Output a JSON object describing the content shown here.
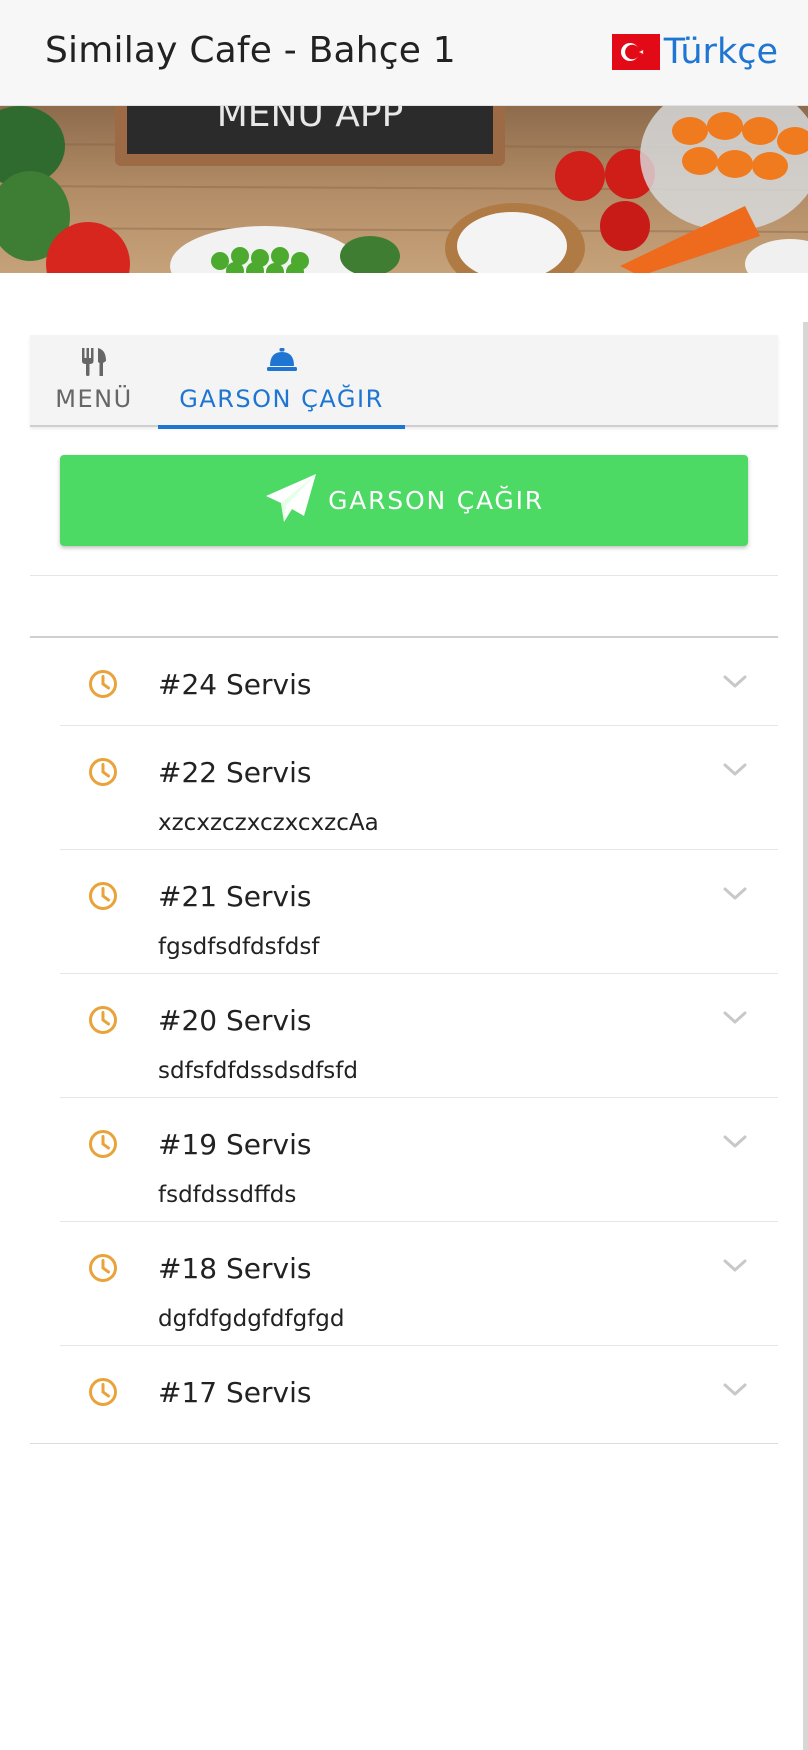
{
  "header": {
    "title": "Similay Cafe - Bahçe 1",
    "language_label": "Türkçe",
    "flag_icon": "turkey-flag-icon"
  },
  "banner": {
    "chalkboard_text": "MENU APP"
  },
  "tabs": [
    {
      "label": "MENÜ",
      "icon": "fork-knife-icon",
      "active": false
    },
    {
      "label": "GARSON ÇAĞIR",
      "icon": "service-bell-icon",
      "active": true
    }
  ],
  "call_button": {
    "label": "GARSON ÇAĞIR",
    "icon": "paper-plane-icon",
    "color": "#4cd964"
  },
  "requests": [
    {
      "title": "#24 Servis",
      "note": ""
    },
    {
      "title": "#22 Servis",
      "note": "xzcxzczxczxcxzcAa"
    },
    {
      "title": "#21 Servis",
      "note": "fgsdfsdfdsfdsf"
    },
    {
      "title": "#20 Servis",
      "note": "sdfsfdfdssdsdfsfd"
    },
    {
      "title": "#19 Servis",
      "note": "fsdfdssdffds"
    },
    {
      "title": "#18 Servis",
      "note": "dgfdfgdgfdfgfgd"
    },
    {
      "title": "#17 Servis",
      "note": ""
    }
  ],
  "colors": {
    "accent": "#1e76d2",
    "pending_icon": "#e8a33a",
    "button": "#4cd964"
  }
}
